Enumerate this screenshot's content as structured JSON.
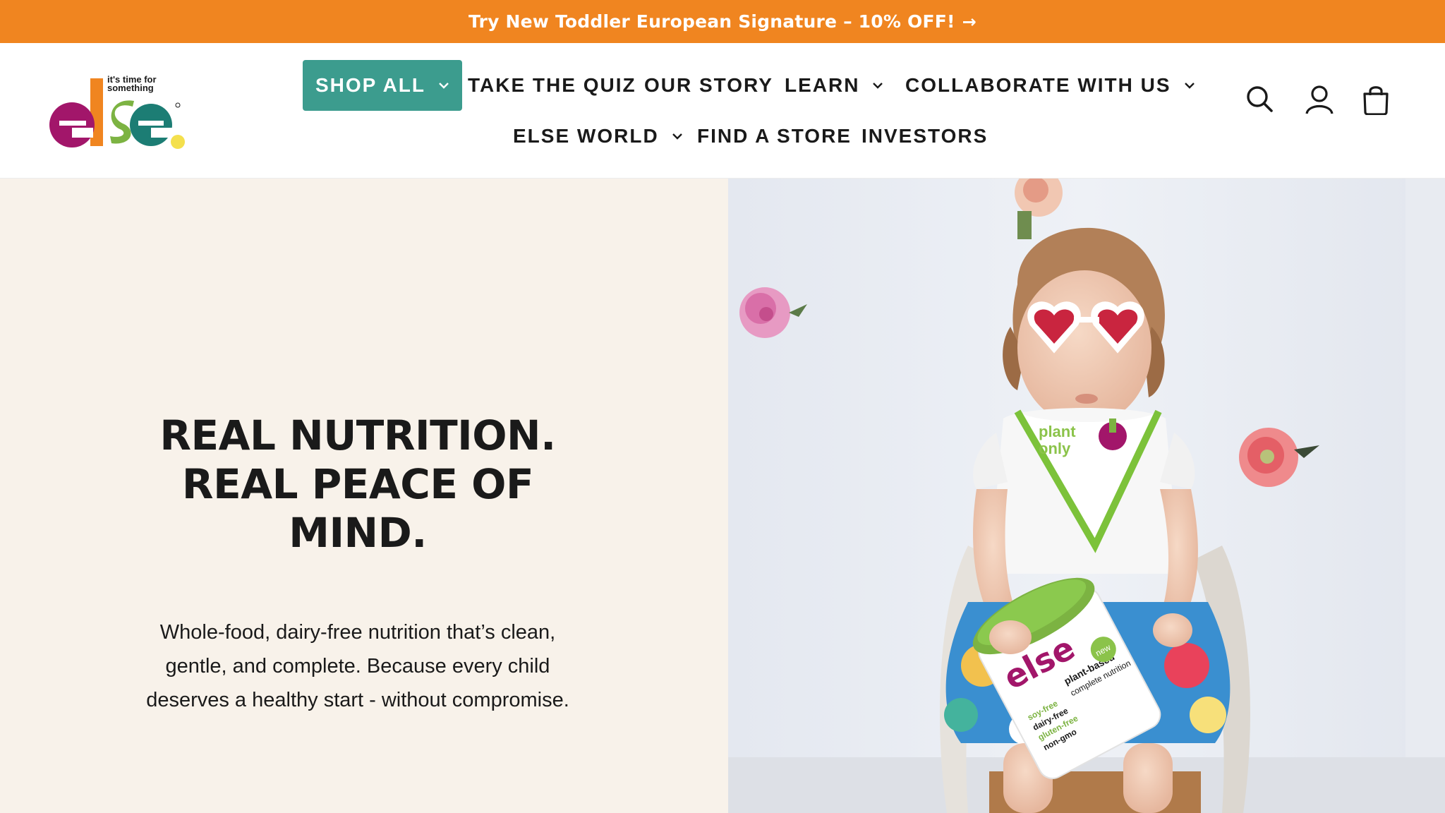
{
  "announcement": {
    "text": "Try New Toddler European Signature – 10% OFF!",
    "arrow": "→",
    "background": "#f08520"
  },
  "brand": {
    "tagline_line1": "it's time for",
    "tagline_line2": "something",
    "wordmark": "else",
    "colors": {
      "e1": "#a2166a",
      "l": "#f08520",
      "s": "#7cb342",
      "e2": "#1c7d74",
      "dot": "#f4e04d"
    }
  },
  "nav": {
    "accent": "#3c9c8e",
    "items": [
      {
        "label": "SHOP ALL",
        "has_dropdown": true,
        "active": true
      },
      {
        "label": "TAKE THE QUIZ",
        "has_dropdown": false
      },
      {
        "label": "OUR STORY",
        "has_dropdown": false
      },
      {
        "label": "LEARN",
        "has_dropdown": true
      },
      {
        "label": "COLLABORATE WITH US",
        "has_dropdown": true
      },
      {
        "label": "ELSE WORLD",
        "has_dropdown": true
      },
      {
        "label": "FIND A STORE",
        "has_dropdown": false
      },
      {
        "label": "INVESTORS",
        "has_dropdown": false
      }
    ]
  },
  "header_icons": [
    "search-icon",
    "account-icon",
    "cart-icon"
  ],
  "hero": {
    "headline": "REAL NUTRITION. REAL PEACE OF MIND.",
    "subcopy": "Whole-food, dairy-free nutrition that’s clean, gentle, and complete. Because every child deserves a healthy start - without compromise.",
    "background": "#f8f2ea",
    "image_alt": "Toddler in heart-shaped sunglasses holding a can of Else plant-based complete nutrition",
    "product_can": {
      "brand": "else",
      "lines": [
        "plant-based",
        "complete nutrition",
        "soy-free",
        "dairy-free",
        "gluten-free",
        "non-gmo"
      ],
      "badge": "new"
    },
    "bib_text": [
      "plant",
      "only"
    ]
  }
}
